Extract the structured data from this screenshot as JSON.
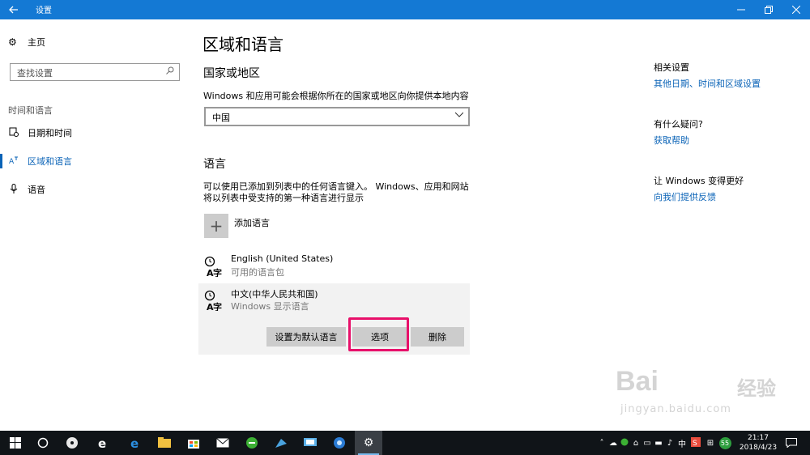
{
  "window": {
    "title": "设置"
  },
  "icons": {
    "back": "back-arrow-icon",
    "minimize": "minimize-icon",
    "maximize": "maximize-icon",
    "close": "close-icon"
  },
  "sidebar": {
    "home_label": "主页",
    "search_placeholder": "查找设置",
    "section_label": "时间和语言",
    "items": [
      {
        "label": "日期和时间",
        "icon": "calendar-clock-icon"
      },
      {
        "label": "区域和语言",
        "icon": "region-language-icon",
        "active": true
      },
      {
        "label": "语音",
        "icon": "microphone-icon"
      }
    ]
  },
  "main": {
    "title": "区域和语言",
    "country_heading": "国家或地区",
    "country_desc": "Windows 和应用可能会根据你所在的国家或地区向你提供本地内容",
    "country_value": "中国",
    "language_heading": "语言",
    "language_desc": "可以使用已添加到列表中的任何语言键入。 Windows、应用和网站将以列表中受支持的第一种语言进行显示",
    "add_language_label": "添加语言",
    "languages": [
      {
        "name": "English (United States)",
        "sub": "可用的语言包"
      },
      {
        "name": "中文(中华人民共和国)",
        "sub": "Windows 显示语言"
      }
    ],
    "buttons": {
      "set_default": "设置为默认语言",
      "options": "选项",
      "remove": "删除"
    }
  },
  "right": {
    "related_heading": "相关设置",
    "related_link": "其他日期、时间和区域设置",
    "question_heading": "有什么疑问?",
    "help_link": "获取帮助",
    "improve_heading": "让 Windows 变得更好",
    "feedback_link": "向我们提供反馈"
  },
  "watermark": {
    "line1": "Bai",
    "line2": "经验",
    "line3": "jingyan.baidu.com"
  },
  "taskbar": {
    "time": "21:17",
    "date": "2018/4/23",
    "ime": "中",
    "badge": "55"
  },
  "colors": {
    "accent": "#1479d4",
    "link": "#0a63b7",
    "highlight": "#e8106a"
  }
}
